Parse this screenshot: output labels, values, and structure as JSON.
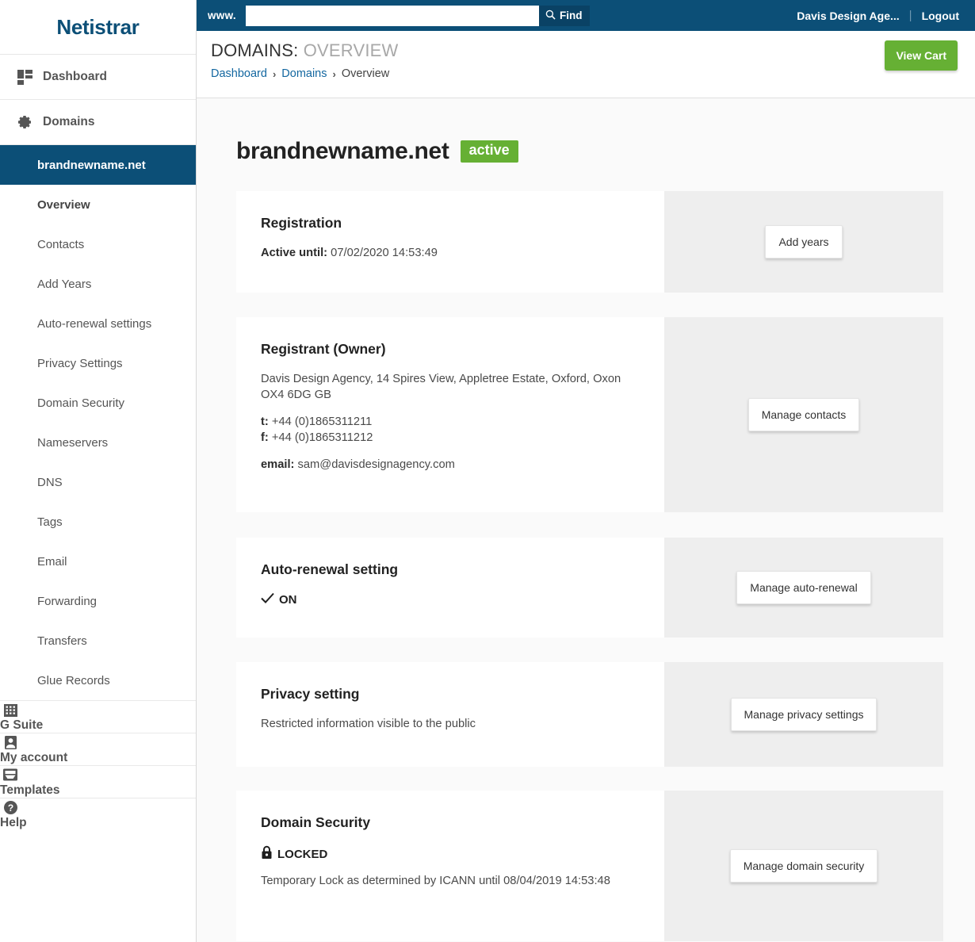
{
  "brand": {
    "name": "Netistrar"
  },
  "topbar": {
    "www_label": "www.",
    "search_value": "",
    "search_placeholder": "",
    "find_label": "Find",
    "account_label": "Davis Design Age...",
    "separator": "|",
    "logout_label": "Logout"
  },
  "pagehead": {
    "title_main": "DOMAINS:",
    "title_sub": "OVERVIEW",
    "breadcrumb": [
      "Dashboard",
      "Domains",
      "Overview"
    ],
    "chevron": "›",
    "view_cart_label": "View Cart"
  },
  "sidebar": {
    "top_items": [
      {
        "label": "Dashboard",
        "icon": "dashboard-grid-icon"
      },
      {
        "label": "Domains",
        "icon": "gear-icon"
      }
    ],
    "active_domain": "brandnewname.net",
    "sub_items": [
      "Overview",
      "Contacts",
      "Add Years",
      "Auto-renewal settings",
      "Privacy Settings",
      "Domain Security",
      "Nameservers",
      "DNS",
      "Tags",
      "Email",
      "Forwarding",
      "Transfers",
      "Glue Records"
    ],
    "bottom_items": [
      {
        "label": "G Suite",
        "icon": "building-icon"
      },
      {
        "label": "My account",
        "icon": "person-icon"
      },
      {
        "label": "Templates",
        "icon": "inbox-icon"
      },
      {
        "label": "Help",
        "icon": "question-circle-icon"
      }
    ]
  },
  "domain": {
    "name": "brandnewname.net",
    "status_badge": "active"
  },
  "cards": {
    "registration": {
      "title": "Registration",
      "label": "Active until:",
      "value": "07/02/2020 14:53:49",
      "button": "Add years"
    },
    "registrant": {
      "title": "Registrant (Owner)",
      "address": "Davis Design Agency, 14 Spires View, Appletree Estate, Oxford, Oxon OX4 6DG GB",
      "tel_label": "t:",
      "tel_value": "+44 (0)1865311211",
      "fax_label": "f:",
      "fax_value": "+44 (0)1865311212",
      "email_label": "email:",
      "email_value": "sam@davisdesignagency.com",
      "button": "Manage contacts"
    },
    "autorenewal": {
      "title": "Auto-renewal setting",
      "status_icon": "check-icon",
      "status": "ON",
      "button": "Manage auto-renewal"
    },
    "privacy": {
      "title": "Privacy setting",
      "value": "Restricted information visible to the public",
      "button": "Manage privacy settings"
    },
    "security": {
      "title": "Domain Security",
      "status_icon": "lock-icon",
      "status": "LOCKED",
      "detail": "Temporary Lock as determined by ICANN until 08/04/2019 14:53:48",
      "button": "Manage domain security"
    }
  },
  "colors": {
    "brand_blue": "#0c4f77",
    "accent_green": "#66b034",
    "panel_grey": "#eeeeee",
    "page_bg": "#fafafa",
    "link_blue": "#1367a0"
  }
}
